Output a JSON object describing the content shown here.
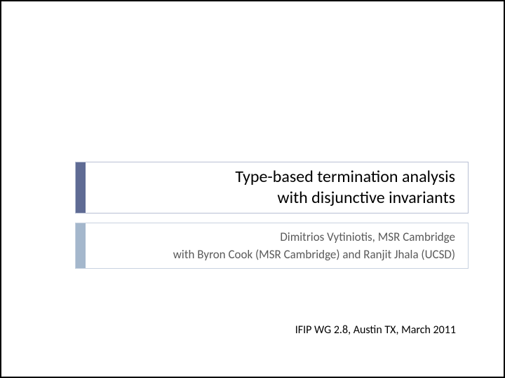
{
  "title": {
    "line1": "Type-based termination analysis",
    "line2": "with disjunctive invariants"
  },
  "subtitle": {
    "line1": "Dimitrios Vytiniotis, MSR Cambridge",
    "line2": "with Byron Cook (MSR Cambridge) and Ranjit Jhala (UCSD)"
  },
  "footer": "IFIP WG 2.8, Austin TX, March 2011",
  "colors": {
    "title_accent": "#5f6b94",
    "subtitle_accent": "#a4b7cc",
    "border": "#b8c0d4",
    "subtitle_text": "#5a5a5a"
  }
}
